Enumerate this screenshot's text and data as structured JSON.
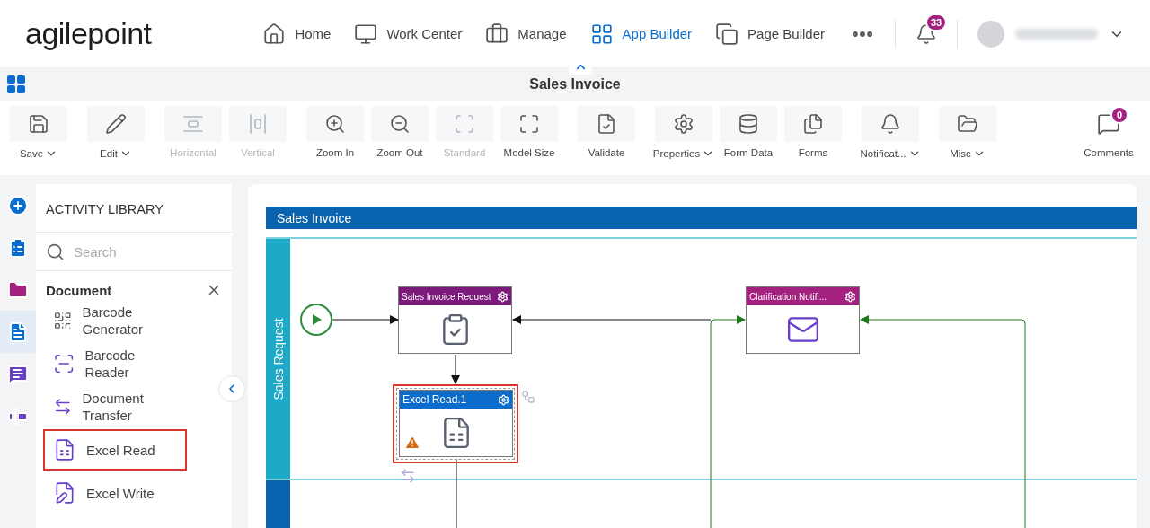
{
  "header": {
    "logo": "agilepoint",
    "nav": [
      {
        "label": "Home",
        "kind": "home",
        "selected": false
      },
      {
        "label": "Work Center",
        "kind": "monitor",
        "selected": false
      },
      {
        "label": "Manage",
        "kind": "briefcase",
        "selected": false
      },
      {
        "label": "App Builder",
        "kind": "grid",
        "selected": true
      },
      {
        "label": "Page Builder",
        "kind": "copy",
        "selected": false
      }
    ],
    "notifications": "33"
  },
  "title": "Sales Invoice",
  "toolbar": [
    [
      {
        "label": "Save",
        "kind": "save",
        "dropdown": true,
        "disabled": false
      }
    ],
    [
      {
        "label": "Edit",
        "kind": "pencil",
        "dropdown": true,
        "disabled": false
      }
    ],
    [
      {
        "label": "Horizontal",
        "kind": "horizontal",
        "dropdown": false,
        "disabled": true
      },
      {
        "label": "Vertical",
        "kind": "vertical",
        "dropdown": false,
        "disabled": true
      }
    ],
    [
      {
        "label": "Zoom In",
        "kind": "zoomin",
        "dropdown": false,
        "disabled": false
      },
      {
        "label": "Zoom Out",
        "kind": "zoomout",
        "dropdown": false,
        "disabled": false
      },
      {
        "label": "Standard",
        "kind": "standard",
        "dropdown": false,
        "disabled": true
      },
      {
        "label": "Model Size",
        "kind": "modelsize",
        "dropdown": false,
        "disabled": false
      }
    ],
    [
      {
        "label": "Validate",
        "kind": "validate",
        "dropdown": false,
        "disabled": false
      }
    ],
    [
      {
        "label": "Properties",
        "kind": "gear",
        "dropdown": true,
        "disabled": false
      },
      {
        "label": "Form Data",
        "kind": "database",
        "dropdown": false,
        "disabled": false
      },
      {
        "label": "Forms",
        "kind": "forms",
        "dropdown": false,
        "disabled": false
      }
    ],
    [
      {
        "label": "Notificat...",
        "kind": "bell",
        "dropdown": true,
        "disabled": false
      }
    ],
    [
      {
        "label": "Misc",
        "kind": "folder",
        "dropdown": true,
        "disabled": false
      }
    ]
  ],
  "comments": {
    "label": "Comments",
    "count": "0"
  },
  "rail": [
    {
      "kind": "plus",
      "color": "#0a6ccd",
      "selected": false
    },
    {
      "kind": "clipboard",
      "color": "#0a6ccd",
      "selected": false
    },
    {
      "kind": "folder",
      "color": "#a3227f",
      "selected": false
    },
    {
      "kind": "doc",
      "color": "#0a6ccd",
      "selected": true
    },
    {
      "kind": "chat",
      "color": "#6a3fc8",
      "selected": false
    },
    {
      "kind": "cursor",
      "color": "#6a3fc8",
      "selected": false
    }
  ],
  "library": {
    "title": "ACTIVITY LIBRARY",
    "search": {
      "placeholder": "Search"
    },
    "category": "Document",
    "items": [
      {
        "label": "Barcode Generator",
        "kind": "qrcode",
        "selected": false
      },
      {
        "label": "Barcode Reader",
        "kind": "scanner",
        "selected": false
      },
      {
        "label": "Document Transfer",
        "kind": "transfer",
        "selected": false
      },
      {
        "label": "Excel Read",
        "kind": "sheetread",
        "selected": true
      },
      {
        "label": "Excel Write",
        "kind": "sheetwrite",
        "selected": false
      }
    ]
  },
  "diagram": {
    "pool": "Sales Invoice",
    "lane": "Sales Request",
    "nodes": [
      {
        "title": "Sales Invoice Request",
        "kind": "form",
        "color": "#7b1a7a",
        "selected": false,
        "warning": false
      },
      {
        "title": "Excel Read.1",
        "kind": "sheetread",
        "color": "#0a6ccd",
        "selected": true,
        "warning": true
      },
      {
        "title": "Clarification Notifi...",
        "kind": "mail",
        "color": "#a3227f",
        "selected": false,
        "warning": false
      }
    ]
  }
}
